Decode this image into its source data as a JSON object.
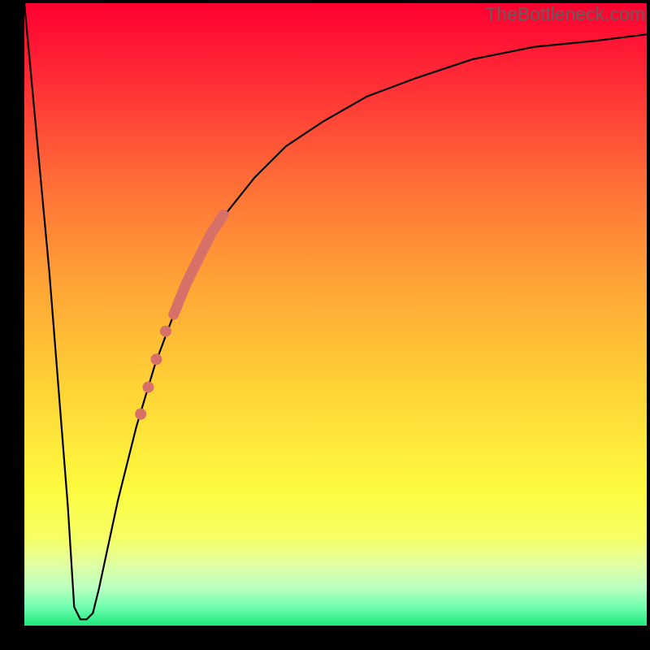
{
  "watermark": "TheBottleneck.com",
  "colors": {
    "curve": "#000000",
    "highlight": "#d77168",
    "gradient_top": "#ff0030",
    "gradient_bottom": "#20e87c"
  },
  "chart_data": {
    "type": "line",
    "title": "",
    "xlabel": "",
    "ylabel": "",
    "xlim": [
      0,
      100
    ],
    "ylim": [
      0,
      100
    ],
    "grid": false,
    "legend": false,
    "series": [
      {
        "name": "bottleneck-curve",
        "x": [
          0,
          4,
          7,
          8,
          9,
          10,
          11,
          12,
          15,
          18,
          21,
          24,
          27,
          30,
          33,
          37,
          42,
          48,
          55,
          63,
          72,
          82,
          92,
          100
        ],
        "y": [
          100,
          57,
          19,
          3,
          1,
          1,
          2,
          6,
          20,
          32,
          42,
          50,
          57,
          63,
          67,
          72,
          77,
          81,
          85,
          88,
          91,
          93,
          94,
          95
        ],
        "color": "#000000"
      }
    ],
    "highlight_segment": {
      "name": "thick-range",
      "color": "#d77168",
      "width": 13,
      "x": [
        24,
        25,
        26,
        27,
        28,
        29,
        30,
        31,
        32
      ],
      "y": [
        50,
        52.5,
        55,
        57,
        59,
        61,
        63,
        64.5,
        66
      ]
    },
    "highlight_points": {
      "name": "dots",
      "color": "#d77168",
      "radius": 7,
      "points": [
        {
          "x": 22.7,
          "y": 47.3
        },
        {
          "x": 21.2,
          "y": 42.8
        },
        {
          "x": 19.9,
          "y": 38.3
        },
        {
          "x": 18.7,
          "y": 34.0
        }
      ]
    }
  }
}
